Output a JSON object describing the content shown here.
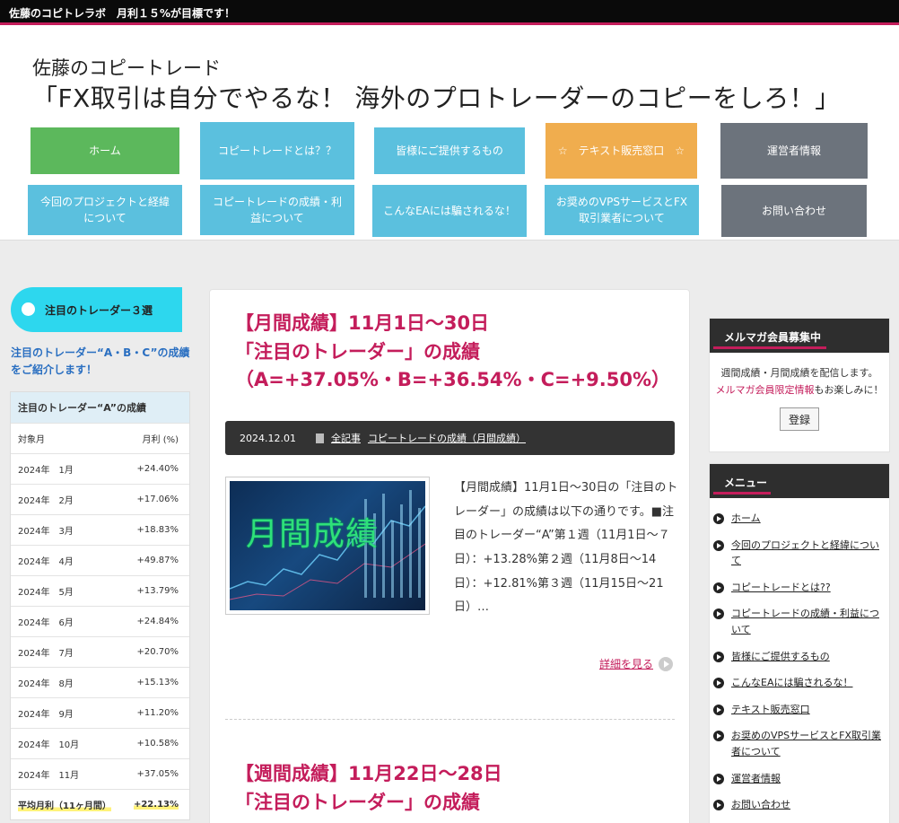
{
  "topbar": {
    "text": "佐藤のコピトレラボ　月利１５%が目標です！"
  },
  "header": {
    "subtitle": "佐藤のコピートレード",
    "title": "「FX取引は自分でやるな！ 海外のプロトレーダーのコピーをしろ！」"
  },
  "nav": [
    {
      "label": "ホーム",
      "color": "#5cb85c"
    },
    {
      "label": "コピートレードとは？？",
      "color": "#5bc0de"
    },
    {
      "label": "皆様にご提供するもの",
      "color": "#5bc0de"
    },
    {
      "label": "☆　テキスト販売窓口　☆",
      "color": "#f0ad4e"
    },
    {
      "label": "運営者情報",
      "color": "#6c737c"
    },
    {
      "label": "今回のプロジェクトと経緯について",
      "color": "#5bc0de"
    },
    {
      "label": "コピートレードの成績・利益について",
      "color": "#5bc0de"
    },
    {
      "label": "こんなEAには騙されるな！",
      "color": "#5bc0de"
    },
    {
      "label": "お奨めのVPSサービスとFX取引業者について",
      "color": "#5bc0de"
    },
    {
      "label": "お問い合わせ",
      "color": "#6c737c"
    }
  ],
  "left_sidebar": {
    "heading": "注目のトレーダー３選",
    "intro": "注目のトレーダー“A・B・C”の成績をご紹介します！",
    "table": {
      "caption": "注目のトレーダー“A”の成績",
      "headers": [
        "対象月",
        "月利 (%)"
      ],
      "rows": [
        [
          "2024年　1月",
          "+24.40%"
        ],
        [
          "2024年　2月",
          "+17.06%"
        ],
        [
          "2024年　3月",
          "+18.83%"
        ],
        [
          "2024年　4月",
          "+49.87%"
        ],
        [
          "2024年　5月",
          "+13.79%"
        ],
        [
          "2024年　6月",
          "+24.84%"
        ],
        [
          "2024年　7月",
          "+20.70%"
        ],
        [
          "2024年　8月",
          "+15.13%"
        ],
        [
          "2024年　9月",
          "+11.20%"
        ],
        [
          "2024年　10月",
          "+10.58%"
        ],
        [
          "2024年　11月",
          "+37.05%"
        ]
      ],
      "average": [
        "平均月利（11ヶ月間）",
        "+22.13%"
      ]
    }
  },
  "posts": [
    {
      "title_lines": [
        "【月間成績】11月1日～30日",
        "「注目のトレーダー」の成績",
        "（A=+37.05%・B=+36.54%・C=+9.50%）"
      ],
      "date": "2024.12.01",
      "categories": [
        "全記事",
        "コピートレードの成績（月間成績）"
      ],
      "thumb_text": "月間成績",
      "excerpt": "【月間成績】11月1日～30日の「注目のトレーダー」の成績は以下の通りです。■注目のトレーダー“A”第１週（11月1日～７日）：+13.28%第２週（11月8日～14日）：+12.81%第３週（11月15日～21日）…",
      "more": "詳細を見る"
    },
    {
      "title_lines": [
        "【週間成績】11月22日～28日",
        "「注目のトレーダー」の成績"
      ]
    }
  ],
  "right_sidebar": {
    "mailmag": {
      "heading": "メルマガ会員募集中",
      "line1": "週間成績・月間成績を配信します。",
      "line2_pink": "メルマガ会員限定情報",
      "line2_rest": "もお楽しみに！",
      "button": "登録"
    },
    "menu": {
      "heading": "メニュー",
      "items": [
        "ホーム",
        "今回のプロジェクトと経緯について",
        "コピートレードとは??",
        "コピートレードの成績・利益について",
        "皆様にご提供するもの",
        "こんなEAには騙されるな！",
        "テキスト販売窓口",
        "お奨めのVPSサービスとFX取引業者について",
        "運営者情報",
        "お問い合わせ"
      ]
    }
  }
}
